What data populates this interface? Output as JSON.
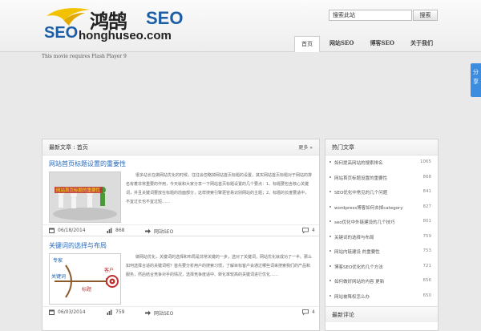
{
  "logo": {
    "cn_text": "鸿鹄",
    "seo_text": "SEO",
    "seo_text_2": "SEO",
    "domain": "honghuseo.com"
  },
  "search": {
    "value": "搜索此站",
    "button_label": "搜索"
  },
  "nav": {
    "items": [
      {
        "label": "首页",
        "active": true
      },
      {
        "label": "网站SEO",
        "active": false
      },
      {
        "label": "博客SEO",
        "active": false
      },
      {
        "label": "关于我们",
        "active": false
      }
    ]
  },
  "flash_notice": "This movie requires Flash Player 9",
  "share_label": "分享",
  "main": {
    "title": "最新文章 : 首页",
    "more": "更多 »",
    "posts": [
      {
        "title": "网站首页标题设置的重要性",
        "thumb_text": "网站首页标题的重要性",
        "excerpt": "很多站长在做网站优化的时候，往往会忽略掉网站首页标题的设置，其实网站首页标题对于网站的排名有着非常重要的作用，今天就和大家分享一下网站首页标题设置的几个要点：1、标题要包含核心关键词，并且关键词要放在标题的前面部分，这样搜索引擎更容易识别网站的主题；2、标题的长度要适中，不宜过长也不宜过短……",
        "date": "06/18/2014",
        "views": "868",
        "category": "网站SEO",
        "comments": "4"
      },
      {
        "title": "关键词的选择与布局",
        "thumb_labels": [
          "专家",
          "客户",
          "关键词",
          "标题"
        ],
        "excerpt": "做网站优化，关键词的选择和布局是非常关键的一步，选对了关键词，网站优化就成功了一半。那么如何选择合适的关键词呢？首先要分析用户的搜索习惯，了解目标客户会通过哪些词来搜索我们的产品和服务，然后结合竞争对手的情况，选择竞争度适中、转化率较高的关键词进行优化……",
        "date": "06/03/2014",
        "views": "759",
        "category": "网站SEO",
        "comments": "4"
      }
    ]
  },
  "sidebar": {
    "title": "热门文章",
    "items": [
      {
        "label": "如何提高网站的搜索排名",
        "count": "1065"
      },
      {
        "label": "网站首页标题设置的重要性",
        "count": "868"
      },
      {
        "label": "SEO优化中常见的几个问题",
        "count": "841"
      },
      {
        "label": "wordpress博客如何去掉category",
        "count": "827"
      },
      {
        "label": "seo优化中外链建设的几个技巧",
        "count": "801"
      },
      {
        "label": "关键词的选择与布局",
        "count": "759"
      },
      {
        "label": "网站内链建设 的重要性",
        "count": "753"
      },
      {
        "label": "博客SEO优化的几个方法",
        "count": "721"
      },
      {
        "label": "如何做好网站的内容 更新",
        "count": "656"
      },
      {
        "label": "网站被降权怎么办",
        "count": "650"
      }
    ],
    "subtitle": "最新评论"
  },
  "colors": {
    "link": "#2a6ab8",
    "brand_blue": "#1d5fa6",
    "brand_yellow": "#f2c200",
    "share_blue": "#3c8de0"
  }
}
